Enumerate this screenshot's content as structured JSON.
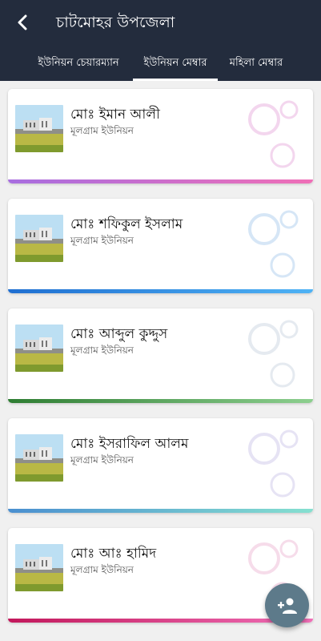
{
  "header": {
    "title": "চাটমোহর উপজেলা",
    "back_icon": "arrow-back-icon"
  },
  "tabs": [
    {
      "label": "ইউনিয়ন চেয়ারম্যান",
      "active": false
    },
    {
      "label": "ইউনিয়ন মেম্বার",
      "active": true
    },
    {
      "label": "মহিলা মেম্বার",
      "active": false
    }
  ],
  "members": [
    {
      "name": "মোঃ ইমান আলী",
      "union": "মূলগ্রাম ইউনিয়ন",
      "accent": [
        "#a86ee0",
        "#f06fb7"
      ],
      "ring_color": "#f3d6ee"
    },
    {
      "name": "মোঃ শফিকুল ইসলাম",
      "union": "মূলগ্রাম ইউনিয়ন",
      "accent": [
        "#1f6fd1",
        "#4fb3f5"
      ],
      "ring_color": "#d6e6f6"
    },
    {
      "name": "মোঃ আব্দুল কুদ্দুস",
      "union": "মূলগ্রাম ইউনিয়ন",
      "accent": [
        "#2e7d32",
        "#8dcf8f"
      ],
      "ring_color": "#e5eaf0"
    },
    {
      "name": "মোঃ ইসরাফিল আলম",
      "union": "মূলগ্রাম ইউনিয়ন",
      "accent": [
        "#4a8fd0",
        "#86e0d0"
      ],
      "ring_color": "#e6e3f4"
    },
    {
      "name": "মোঃ আঃ হামিদ",
      "union": "মূলগ্রাম ইউনিয়ন",
      "accent": [
        "#c2185b",
        "#f06fb7"
      ],
      "ring_color": "#f6dcea"
    }
  ],
  "fab": {
    "icon": "add-person-icon",
    "color": "#5d7a8a"
  },
  "colors": {
    "appbar": "#232c3d",
    "background": "#f0f0f0"
  }
}
